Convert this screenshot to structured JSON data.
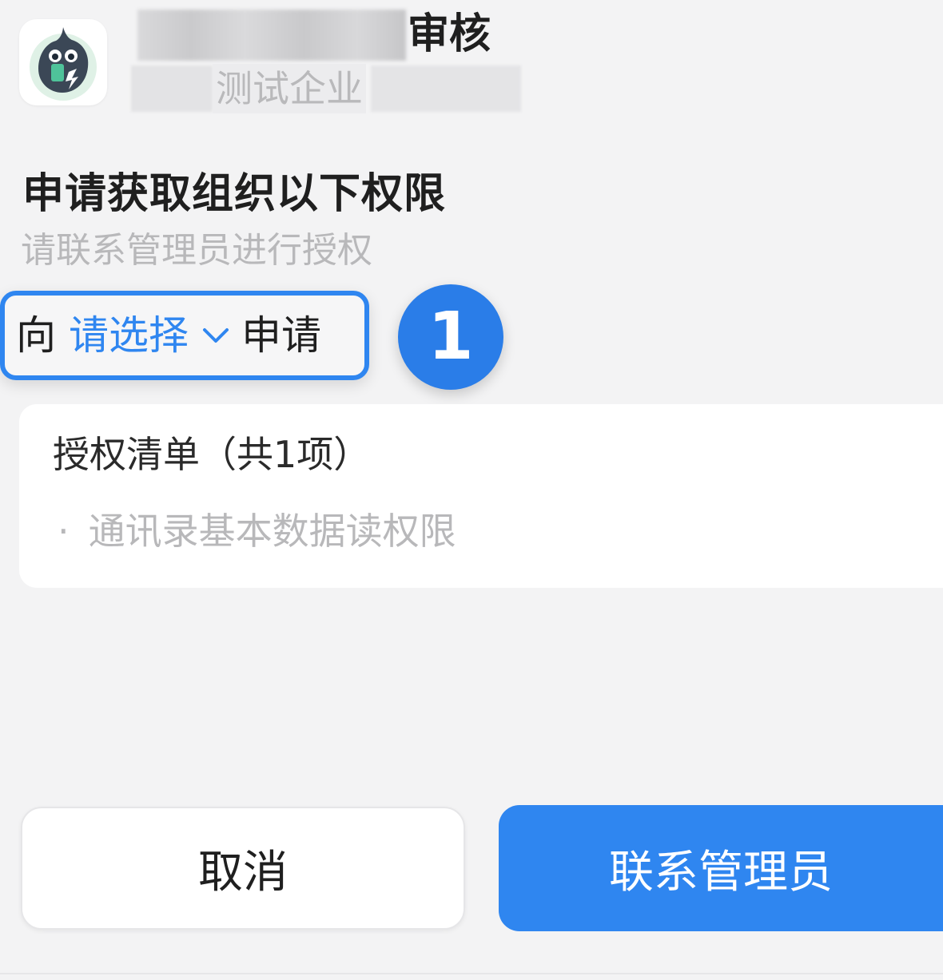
{
  "app": {
    "title_suffix": "审核",
    "org_name": "测试企业",
    "icon": "mascot-app-icon"
  },
  "permission": {
    "heading": "申请获取组织以下权限",
    "subheading": "请联系管理员进行授权"
  },
  "request_target": {
    "prefix": "向",
    "select_placeholder": "请选择",
    "suffix": "申请",
    "step_number": "1"
  },
  "auth_list": {
    "title": "授权清单（共1项）",
    "items": [
      {
        "bullet": "·",
        "label": "通讯录基本数据读权限"
      }
    ]
  },
  "buttons": {
    "cancel": "取消",
    "contact_admin": "联系管理员"
  },
  "colors": {
    "accent": "#2f86f0",
    "background": "#f3f3f4",
    "muted_text": "#b8b8ba",
    "primary_text": "#1f1f1f"
  }
}
